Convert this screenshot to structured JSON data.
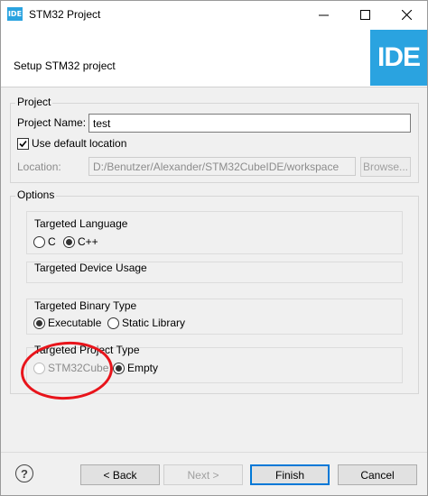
{
  "window": {
    "app_icon_text": "IDE",
    "title": "STM32 Project"
  },
  "header": {
    "title": "Setup STM32 project",
    "logo_text": "IDE"
  },
  "project": {
    "group_title": "Project",
    "name_label": "Project Name:",
    "name_value": "test",
    "use_default_label": "Use default location",
    "use_default_checked": true,
    "location_label": "Location:",
    "location_value": "D:/Benutzer/Alexander/STM32CubeIDE/workspace",
    "browse_label": "Browse..."
  },
  "options": {
    "group_title": "Options",
    "targeted_language": {
      "title": "Targeted Language",
      "options": [
        "C",
        "C++"
      ],
      "selected": "C++"
    },
    "targeted_device_usage": {
      "title": "Targeted Device Usage"
    },
    "targeted_binary_type": {
      "title": "Targeted Binary Type",
      "options": [
        "Executable",
        "Static Library"
      ],
      "selected": "Executable"
    },
    "targeted_project_type": {
      "title": "Targeted Project Type",
      "options": [
        "STM32Cube",
        "Empty"
      ],
      "selected": "Empty",
      "disabled_option": "STM32Cube"
    }
  },
  "footer": {
    "help_symbol": "?",
    "back_label": "< Back",
    "next_label": "Next >",
    "finish_label": "Finish",
    "cancel_label": "Cancel"
  },
  "colors": {
    "accent": "#2aa3e0",
    "annotation": "#e8141b",
    "default_button_border": "#0078d7"
  }
}
